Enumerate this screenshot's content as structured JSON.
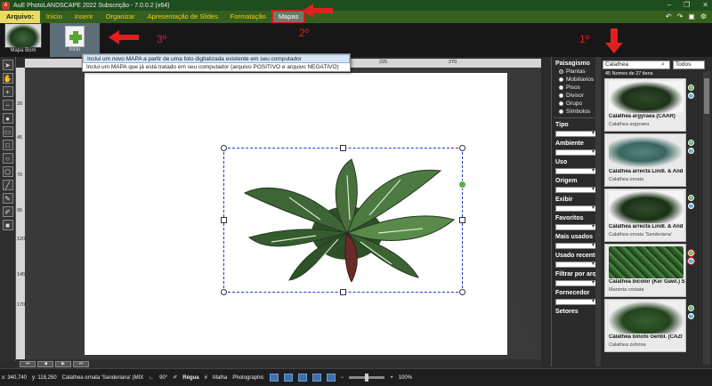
{
  "window": {
    "title": "AuE PhotoLANDSCAPE 2022 Subscrição - 7.0.0.2 (x64)"
  },
  "menu": {
    "items": [
      {
        "label": "Arquivo:"
      },
      {
        "label": "Início"
      },
      {
        "label": "Inserir"
      },
      {
        "label": "Organizar"
      },
      {
        "label": "Apresentação de Slides"
      },
      {
        "label": "Formatação"
      },
      {
        "label": "Mapas"
      }
    ]
  },
  "ribbon": {
    "thumb_label": "Mapa Bom",
    "add_label": "Inclu"
  },
  "annotations": {
    "step1": "1º",
    "step2": "2º",
    "step3": "3º"
  },
  "dropdown": {
    "items": [
      "Inclui um novo MAPA a partir de uma foto digitalizada existente em seu computador",
      "Inclui um MAPA que já está tratado em seu computador (arquivo POSITIVO e arquivo NEGATIVO)"
    ]
  },
  "ruler": {
    "h_ticks": [
      "45",
      "90",
      "135",
      "180",
      "225",
      "270"
    ],
    "v_ticks": [
      "20",
      "45",
      "70",
      "95",
      "120",
      "145",
      "170"
    ]
  },
  "filters": {
    "paisagismo_title": "Paisagismo",
    "options": [
      "Plantas",
      "Mobiliarios",
      "Pisos",
      "Divisor",
      "Grupo",
      "Símbolos"
    ],
    "groups": [
      "Tipo",
      "Ambiente",
      "Uso",
      "Origem",
      "Exibir",
      "Favoritos",
      "Mais usados",
      "Usado recente",
      "Filtrar por arq",
      "Fornecedor",
      "Setores"
    ]
  },
  "search": {
    "value": "Calathea",
    "scope": "Todos",
    "results_text": "45 Nomes de 27 itens"
  },
  "plants": [
    {
      "name": "Calathea argyraea (CAAR)",
      "sci": "Calathea argyraea"
    },
    {
      "name": "Calathea arrecta Lindl. & And",
      "sci": "Calathea ornata"
    },
    {
      "name": "Calathea arrecta Lindl. & And",
      "sci": "Calathea ornata 'Sanderiana'"
    },
    {
      "name": "Calathea bicolor (Ker Gawl.) S",
      "sci": "Maranta cristata"
    },
    {
      "name": "Calathea binotii Gentil. (CAZI",
      "sci": "Calathea zebrina"
    }
  ],
  "status": {
    "x": "x: 340,740",
    "y": "y: 118,250",
    "object": "Calathea ornata 'Sanderiana' (MIX",
    "angle": "90°",
    "ruler": "Régua",
    "grid": "Malha",
    "mode": "Photographic",
    "zoom": "100%"
  }
}
